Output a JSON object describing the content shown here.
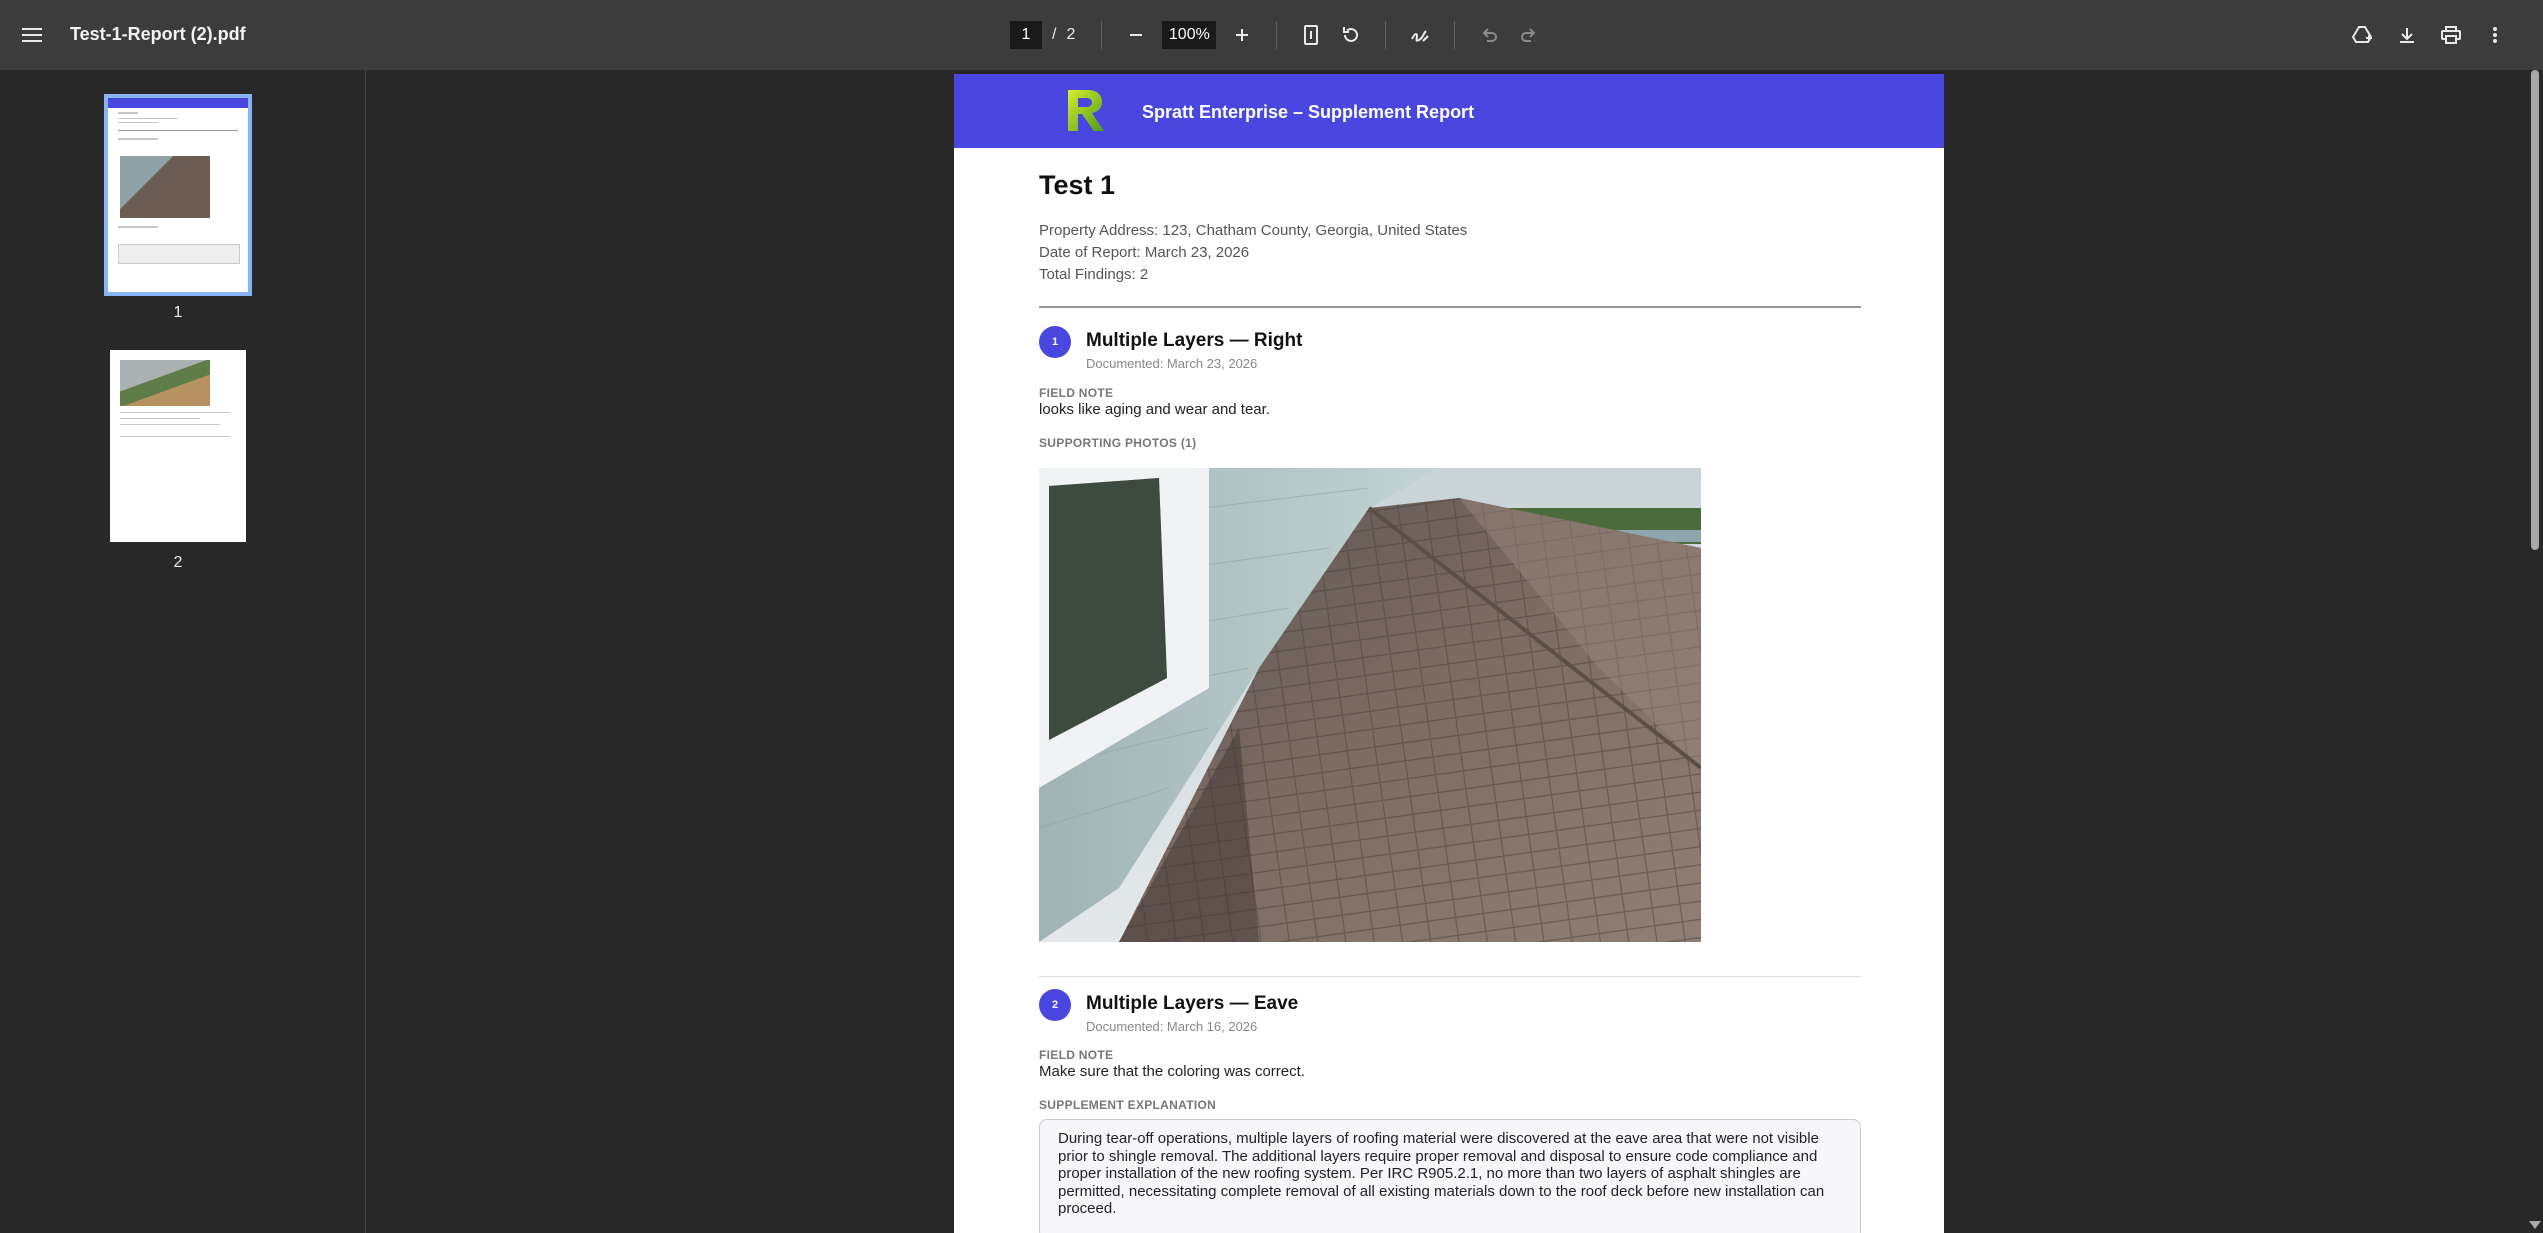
{
  "toolbar": {
    "file_name": "Test-1-Report (2).pdf",
    "current_page": "1",
    "page_separator": "/",
    "total_pages": "2",
    "zoom": "100%"
  },
  "sidebar": {
    "thumbnails": [
      {
        "label": "1",
        "selected": true
      },
      {
        "label": "2",
        "selected": false
      }
    ]
  },
  "report": {
    "header_title": "Spratt Enterprise – Supplement Report",
    "title": "Test 1",
    "property_address": "Property Address: 123, Chatham County, Georgia, United States",
    "date_of_report": "Date of Report: March 23, 2026",
    "total_findings": "Total Findings: 2",
    "findings": [
      {
        "number": "1",
        "title": "Multiple Layers — Right",
        "documented": "Documented: March 23, 2026",
        "field_note_label": "FIELD NOTE",
        "field_note": "looks like aging and wear and tear.",
        "photos_label": "SUPPORTING PHOTOS (1)"
      },
      {
        "number": "2",
        "title": "Multiple Layers — Eave",
        "documented": "Documented: March 16, 2026",
        "field_note_label": "FIELD NOTE",
        "field_note": "Make sure that the coloring was correct.",
        "explanation_label": "SUPPLEMENT EXPLANATION",
        "explanation": "During tear-off operations, multiple layers of roofing material were discovered at the eave area that were not visible prior to shingle removal. The additional layers require proper removal and disposal to ensure code compliance and proper installation of the new roofing system. Per IRC R905.2.1, no more than two layers of asphalt shingles are permitted, necessitating complete removal of all existing materials down to the roof deck before new installation can proceed."
      }
    ]
  },
  "colors": {
    "accent": "#4a47e0",
    "toolbar_bg": "#3c3c3c",
    "viewer_bg": "#282828"
  }
}
